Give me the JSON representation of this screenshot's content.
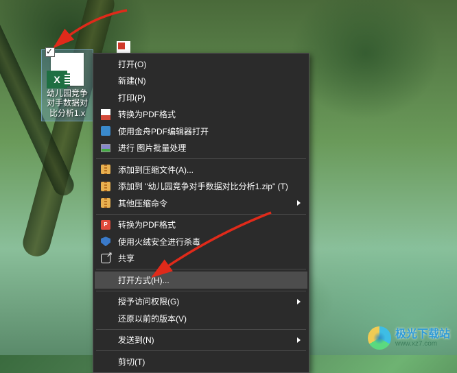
{
  "desktop": {
    "file_label": "幼儿园竞争对手数据对比分析1.x",
    "file_icon_letter": "X"
  },
  "menu": {
    "groups": [
      [
        {
          "key": "open",
          "label": "打开(O)",
          "icon": "",
          "submenu": false
        },
        {
          "key": "new",
          "label": "新建(N)",
          "icon": "",
          "submenu": false
        },
        {
          "key": "print",
          "label": "打印(P)",
          "icon": "",
          "submenu": false
        },
        {
          "key": "to-pdf",
          "label": "转换为PDF格式",
          "icon": "pdf",
          "submenu": false
        },
        {
          "key": "jz-pdf",
          "label": "使用金舟PDF编辑器打开",
          "icon": "jpdf",
          "submenu": false
        },
        {
          "key": "img-batch",
          "label": "进行 图片批量处理",
          "icon": "img",
          "submenu": false
        }
      ],
      [
        {
          "key": "add-zip",
          "label": "添加到压缩文件(A)...",
          "icon": "zip",
          "submenu": false
        },
        {
          "key": "add-named",
          "label": "添加到 \"幼儿园竞争对手数据对比分析1.zip\" (T)",
          "icon": "zip",
          "submenu": false
        },
        {
          "key": "other-zip",
          "label": "其他压缩命令",
          "icon": "zip",
          "submenu": true
        }
      ],
      [
        {
          "key": "to-pdf2",
          "label": "转换为PDF格式",
          "icon": "rpdf",
          "submenu": false
        },
        {
          "key": "huorong",
          "label": "使用火绒安全进行杀毒",
          "icon": "shield",
          "submenu": false
        },
        {
          "key": "share",
          "label": "共享",
          "icon": "share",
          "submenu": false
        }
      ],
      [
        {
          "key": "open-with",
          "label": "打开方式(H)...",
          "icon": "",
          "submenu": false,
          "hover": true
        }
      ],
      [
        {
          "key": "grant",
          "label": "授予访问权限(G)",
          "icon": "",
          "submenu": true
        },
        {
          "key": "restore",
          "label": "还原以前的版本(V)",
          "icon": "",
          "submenu": false
        }
      ],
      [
        {
          "key": "send-to",
          "label": "发送到(N)",
          "icon": "",
          "submenu": true
        }
      ],
      [
        {
          "key": "cut",
          "label": "剪切(T)",
          "icon": "",
          "submenu": false
        }
      ]
    ]
  },
  "watermark": {
    "title": "极光下载站",
    "url": "www.xz7.com"
  },
  "arrows": {
    "a1_note": "top-left red arrow pointing to selected Excel file icon",
    "a2_note": "red arrow pointing to 打开方式(H)... menu item"
  }
}
